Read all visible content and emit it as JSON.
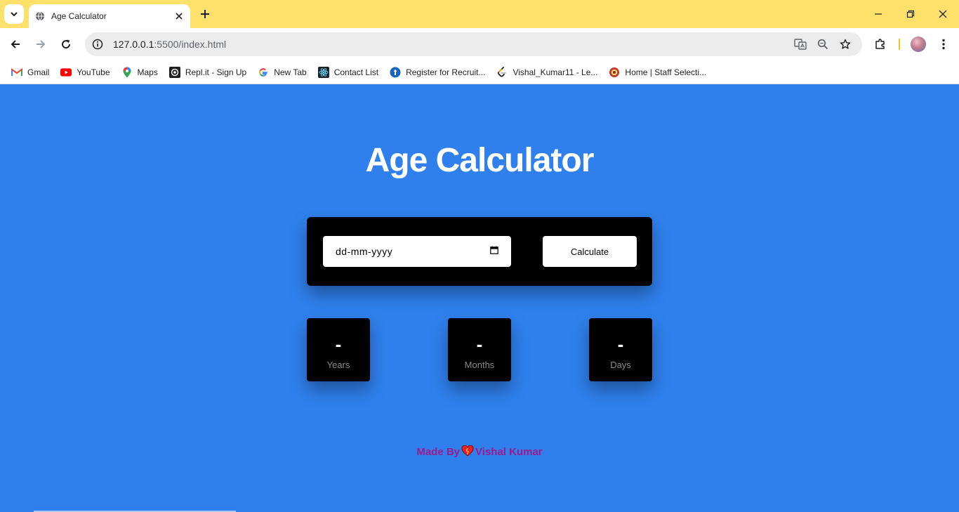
{
  "browser": {
    "tab_title": "Age Calculator",
    "url_host": "127.0.0.1",
    "url_path": ":5500/index.html",
    "bookmarks": [
      {
        "label": "Gmail",
        "icon": "gmail-icon"
      },
      {
        "label": "YouTube",
        "icon": "youtube-icon"
      },
      {
        "label": "Maps",
        "icon": "maps-icon"
      },
      {
        "label": "Repl.it - Sign Up",
        "icon": "replit-icon"
      },
      {
        "label": "New Tab",
        "icon": "google-icon"
      },
      {
        "label": "Contact List",
        "icon": "react-icon"
      },
      {
        "label": "Register for Recruit...",
        "icon": "recruitment-icon"
      },
      {
        "label": "Vishal_Kumar11 - Le...",
        "icon": "leetcode-icon"
      },
      {
        "label": "Home | Staff Selecti...",
        "icon": "ssc-icon"
      }
    ]
  },
  "app": {
    "title": "Age Calculator",
    "date_placeholder": "dd-mm-yyyy",
    "calculate_label": "Calculate",
    "results": [
      {
        "value": "-",
        "label": "Years"
      },
      {
        "value": "-",
        "label": "Months"
      },
      {
        "value": "-",
        "label": "Days"
      }
    ],
    "footer_made_by": "Made By",
    "footer_author": "Vishal Kumar"
  },
  "colors": {
    "page_background": "#2f80ed",
    "tab_strip": "#fde16b",
    "panel": "#000000",
    "footer_text": "#9c1a8c"
  }
}
